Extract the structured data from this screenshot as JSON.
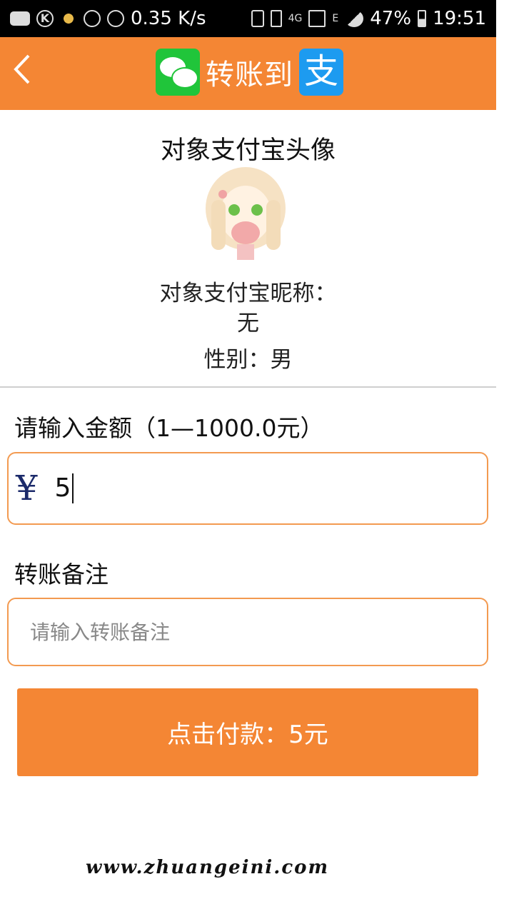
{
  "status_bar": {
    "network_speed": "0.35 K/s",
    "network_type": "4G",
    "sim_label": "E",
    "battery": "47%",
    "time": "19:51"
  },
  "header": {
    "title": "转账到",
    "back_icon": "chevron-left-icon",
    "wechat_logo": "wechat-logo-icon",
    "alipay_logo_char": "支",
    "accent_color": "#f48634"
  },
  "profile": {
    "title": "对象支付宝头像",
    "nickname_label": "对象支付宝昵称：",
    "nickname_value": "无",
    "gender": "性别：男"
  },
  "amount": {
    "label": "请输入金额（1—1000.0元）",
    "currency_symbol": "¥",
    "value": "5"
  },
  "remark": {
    "label": "转账备注",
    "placeholder": "请输入转账备注"
  },
  "pay_button": {
    "label": "点击付款：5元"
  },
  "watermark": "www.zhuangeini.com"
}
